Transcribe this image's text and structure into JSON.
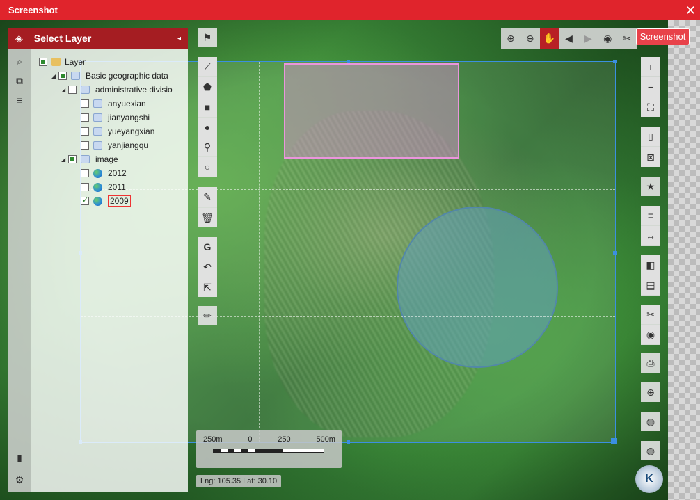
{
  "window": {
    "title": "Screenshot",
    "close": "✕"
  },
  "sidebar": {
    "title": "Select Layer",
    "collapse_arrow": "◂",
    "tree": {
      "root": "Layer",
      "basic": "Basic geographic data",
      "admin": "administrative divisio",
      "items": [
        "anyuexian",
        "jianyangshi",
        "yueyangxian",
        "yanjiangqu"
      ],
      "image": "image",
      "years": [
        "2012",
        "2011",
        "2009"
      ]
    }
  },
  "top_toolbar": {
    "screenshot_label": "Screenshot"
  },
  "scale": {
    "labels": [
      "250m",
      "0",
      "250",
      "500m"
    ]
  },
  "coords": "Lng: 105.35 Lat: 30.10",
  "compass": "K"
}
